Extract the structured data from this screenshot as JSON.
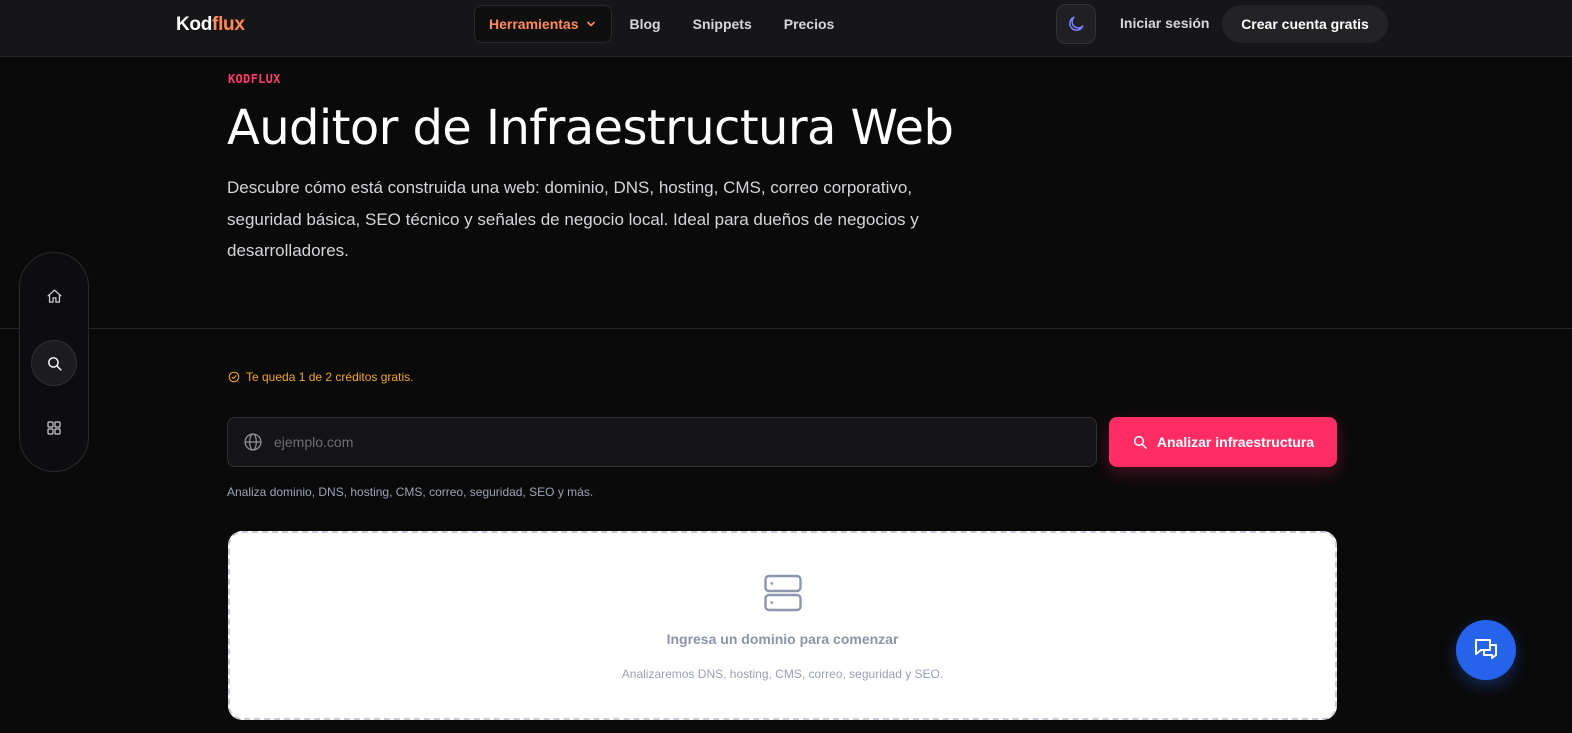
{
  "brand": {
    "name_part1": "Kod",
    "name_part2": "flux",
    "accent": "#ff8a5b"
  },
  "nav": {
    "tools_label": "Herramientas",
    "links": [
      "Blog",
      "Snippets",
      "Precios"
    ]
  },
  "header_actions": {
    "theme_icon": "moon-icon",
    "login_label": "Iniciar sesión",
    "cta_label": "Crear cuenta gratis"
  },
  "hero": {
    "eyebrow": "KODFLUX",
    "title": "Auditor de Infraestructura Web",
    "description": "Descubre cómo está construida una web: dominio, DNS, hosting, CMS, correo corporativo, seguridad básica, SEO técnico y señales de negocio local. Ideal para dueños de negocios y desarrolladores."
  },
  "rail": {
    "items": [
      "home-icon",
      "search-icon",
      "grid-icon"
    ],
    "active": "search-icon"
  },
  "credits": {
    "text": "Te queda 1 de 2 créditos gratis.",
    "color": "#f5a524"
  },
  "search": {
    "placeholder": "ejemplo.com",
    "value": "",
    "button_label": "Analizar infraestructura",
    "button_color": "#ff2d64",
    "hint": "Analiza dominio, DNS, hosting, CMS, correo, seguridad, SEO y más."
  },
  "empty_state": {
    "icon": "server-icon",
    "title": "Ingresa un dominio para comenzar",
    "subtitle": "Analizaremos DNS, hosting, CMS, correo, seguridad y SEO."
  },
  "chat": {
    "icon": "chat-icon",
    "color": "#2563eb"
  }
}
